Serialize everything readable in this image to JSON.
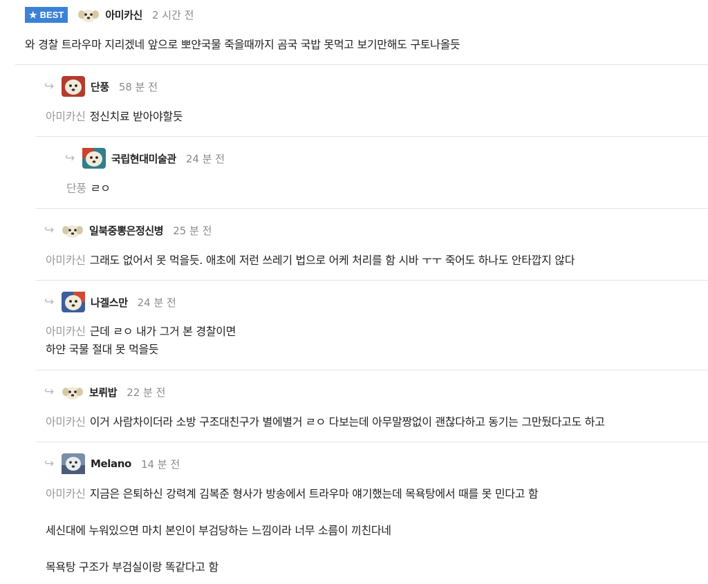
{
  "badge": {
    "label": "BEST"
  },
  "comments": [
    {
      "author": "아미카신",
      "time": "2 시간 전",
      "lines": [
        "와 경찰 트라우마 지리겠네 앞으로 뽀얀국물 죽을때까지 곰국 국밥 못먹고 보기만해도 구토나올듯"
      ]
    },
    {
      "author": "단풍",
      "time": "58 분 전",
      "mention": "아미카신",
      "lines": [
        "정신치료 받아야할듯"
      ]
    },
    {
      "author": "국립현대미술관",
      "time": "24 분 전",
      "mention": "단풍",
      "lines": [
        "ㄹㅇ"
      ]
    },
    {
      "author": "일북중뽕은정신병",
      "time": "25 분 전",
      "mention": "아미카신",
      "lines": [
        "그래도 없어서 못 먹을듯. 애초에 저런 쓰레기 법으로 어케 처리를 함 시바 ㅜㅜ 죽어도 하나도 안타깝지 않다"
      ]
    },
    {
      "author": "나겔스만",
      "time": "24 분 전",
      "mention": "아미카신",
      "lines": [
        "근데 ㄹㅇ 내가 그거 본 경찰이면",
        "하얀 국물 절대 못 먹을듯"
      ]
    },
    {
      "author": "보뤼밥",
      "time": "22 분 전",
      "mention": "아미카신",
      "lines": [
        "이거 사람차이더라 소방 구조대친구가 별에별거 ㄹㅇ 다보는데 아무말짱없이 괜찮다하고 동기는 그만뒀다고도 하고"
      ]
    },
    {
      "author": "Melano",
      "time": "14 분 전",
      "mention": "아미카신",
      "lines": [
        "지금은 은퇴하신 강력계 김복준 형사가 방송에서 트라우마 얘기했는데 목욕탕에서 때를 못 민다고 함",
        "세신대에 누워있으면 마치 본인이 부검당하는 느낌이라 너무 소름이 끼친다네",
        "목욕탕 구조가 부검실이랑 똑같다고 함"
      ]
    }
  ],
  "colors": {
    "badge_bg": "#3b82d6",
    "mention": "#9a9a9a",
    "time": "#8a8a8a",
    "divider": "#e3e3e3"
  },
  "icons": {
    "badge": "star-icon",
    "reply": "reply-arrow-icon",
    "avatar": "puppy-avatar-icon"
  }
}
